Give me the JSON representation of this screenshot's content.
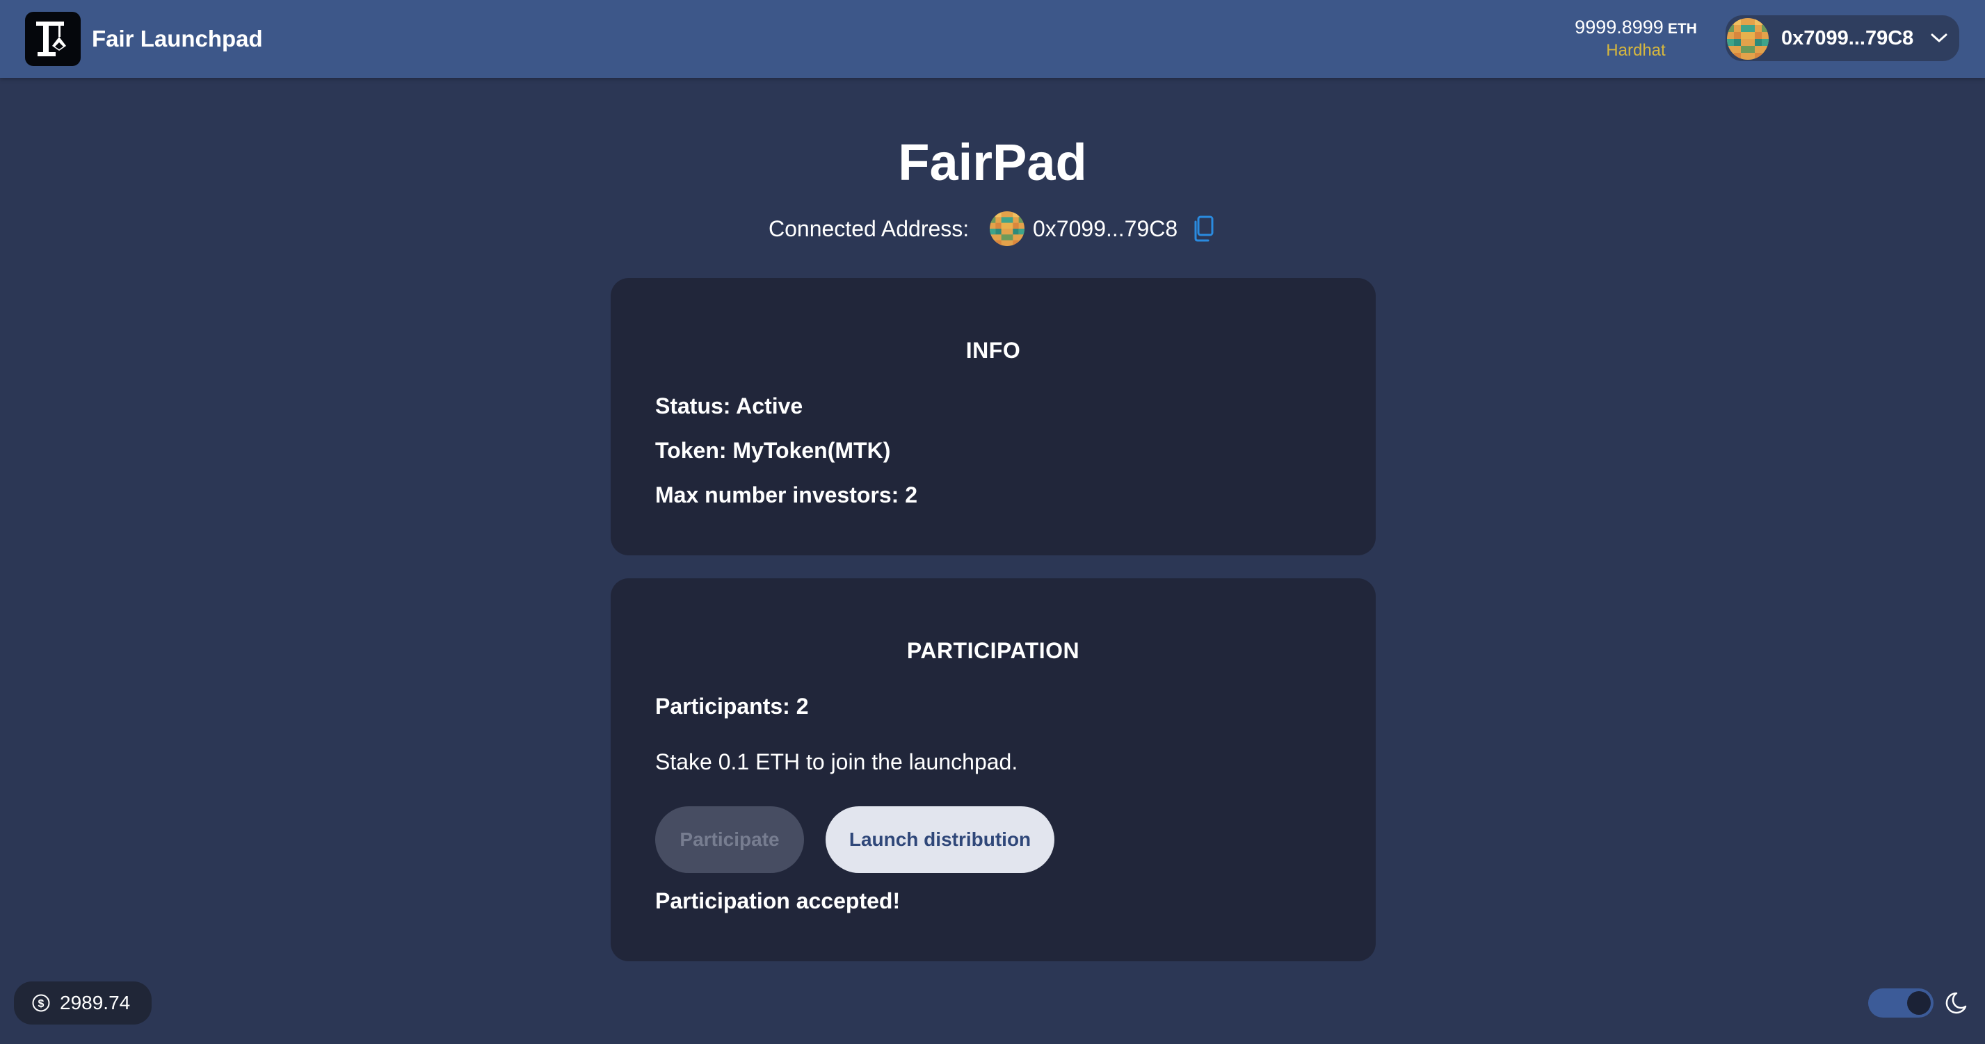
{
  "header": {
    "app_title": "Fair Launchpad",
    "balance_amount": "9999.8999",
    "balance_unit": "ETH",
    "network": "Hardhat",
    "account_address": "0x7099...79C8"
  },
  "main": {
    "title": "FairPad",
    "connected_label": "Connected Address:",
    "connected_address": "0x7099...79C8"
  },
  "info_card": {
    "heading": "INFO",
    "status": "Status: Active",
    "token": "Token: MyToken(MTK)",
    "max_investors": "Max number investors: 2"
  },
  "participation_card": {
    "heading": "PARTICIPATION",
    "participants": "Participants: 2",
    "instructions": "Stake 0.1 ETH to join the launchpad.",
    "participate_label": "Participate",
    "launch_label": "Launch distribution",
    "status_message": "Participation accepted!"
  },
  "footer": {
    "eth_price": "2989.74",
    "theme": "dark"
  },
  "colors": {
    "background": "#2c3755",
    "header": "#3d5789",
    "card": "#21263a",
    "network_accent": "#d6b73e",
    "link_accent": "#2a8be0"
  },
  "icons": [
    "app-logo-icon",
    "chevron-down-icon",
    "copy-icon",
    "dollar-icon",
    "moon-icon"
  ]
}
